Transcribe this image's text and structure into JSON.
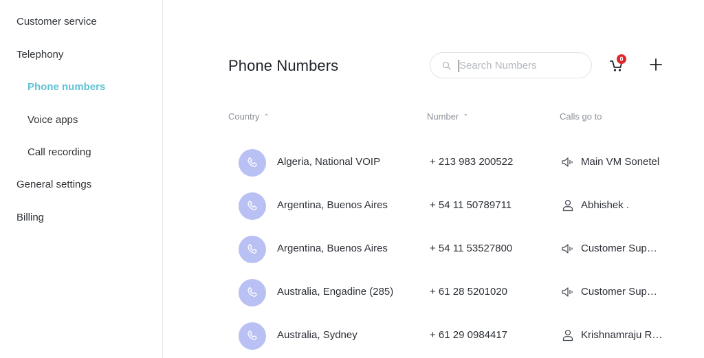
{
  "sidebar": {
    "items": [
      {
        "label": "Customer service",
        "level": "top",
        "active": false
      },
      {
        "label": "Telephony",
        "level": "top",
        "active": false
      },
      {
        "label": "Phone numbers",
        "level": "sub",
        "active": true
      },
      {
        "label": "Voice apps",
        "level": "sub",
        "active": false
      },
      {
        "label": "Call recording",
        "level": "sub",
        "active": false
      },
      {
        "label": "General settings",
        "level": "top",
        "active": false
      },
      {
        "label": "Billing",
        "level": "top",
        "active": false
      }
    ]
  },
  "header": {
    "title": "Phone Numbers",
    "search_placeholder": "Search Numbers",
    "search_value": "",
    "cart_count": "0"
  },
  "table": {
    "columns": [
      {
        "label": "Country",
        "sortable": true,
        "sort": "asc"
      },
      {
        "label": "Number",
        "sortable": true,
        "sort": "asc"
      },
      {
        "label": "Calls go to",
        "sortable": false
      }
    ],
    "rows": [
      {
        "country": "Algeria, National VOIP",
        "number": "+ 213 983 200522",
        "dest_icon": "voice-app-icon",
        "dest": "Main VM Sonetel"
      },
      {
        "country": "Argentina, Buenos Aires",
        "number": "+ 54 11 50789711",
        "dest_icon": "user-icon",
        "dest": "Abhishek ."
      },
      {
        "country": "Argentina, Buenos Aires",
        "number": "+ 54 11 53527800",
        "dest_icon": "voice-app-icon",
        "dest": "Customer Sup…"
      },
      {
        "country": "Australia, Engadine (285)",
        "number": "+ 61 28 5201020",
        "dest_icon": "voice-app-icon",
        "dest": "Customer Sup…"
      },
      {
        "country": "Australia, Sydney",
        "number": "+ 61 29 0984417",
        "dest_icon": "user-icon",
        "dest": "Krishnamraju R…"
      }
    ]
  },
  "colors": {
    "accent": "#5ec2d6",
    "avatar_bg": "#b9c0f3",
    "badge": "#e0262b"
  }
}
